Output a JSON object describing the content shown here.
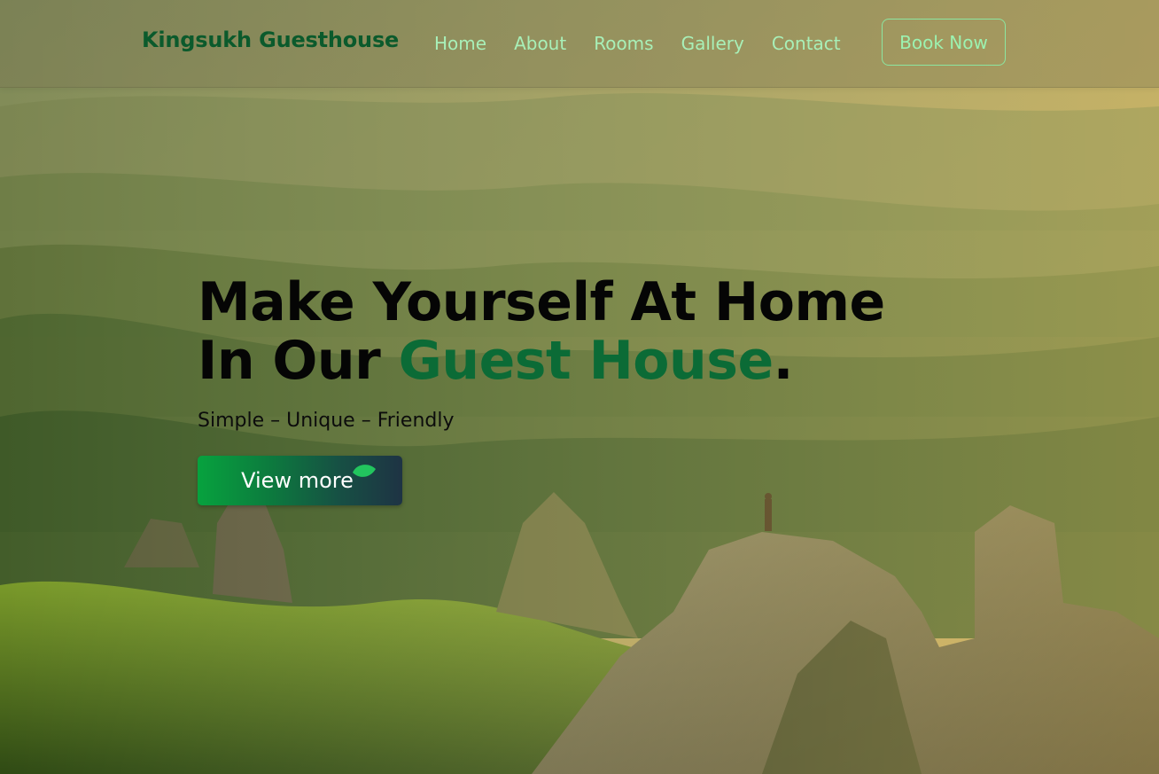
{
  "brand": {
    "name": "Kingsukh Guesthouse"
  },
  "nav": {
    "links": [
      "Home",
      "About",
      "Rooms",
      "Gallery",
      "Contact"
    ],
    "cta": "Book Now"
  },
  "hero": {
    "headline_part1": "Make Yourself At Home In Our ",
    "headline_accent": "Guest House",
    "headline_end": ".",
    "tagline": "Simple – Unique – Friendly",
    "button": "View more"
  },
  "colors": {
    "brand_text": "#0b5a2c",
    "nav_link": "#a8f0b8",
    "accent_green": "#0b6b36",
    "button_gradient_start": "#07a23e",
    "button_gradient_end": "#1e3344"
  }
}
